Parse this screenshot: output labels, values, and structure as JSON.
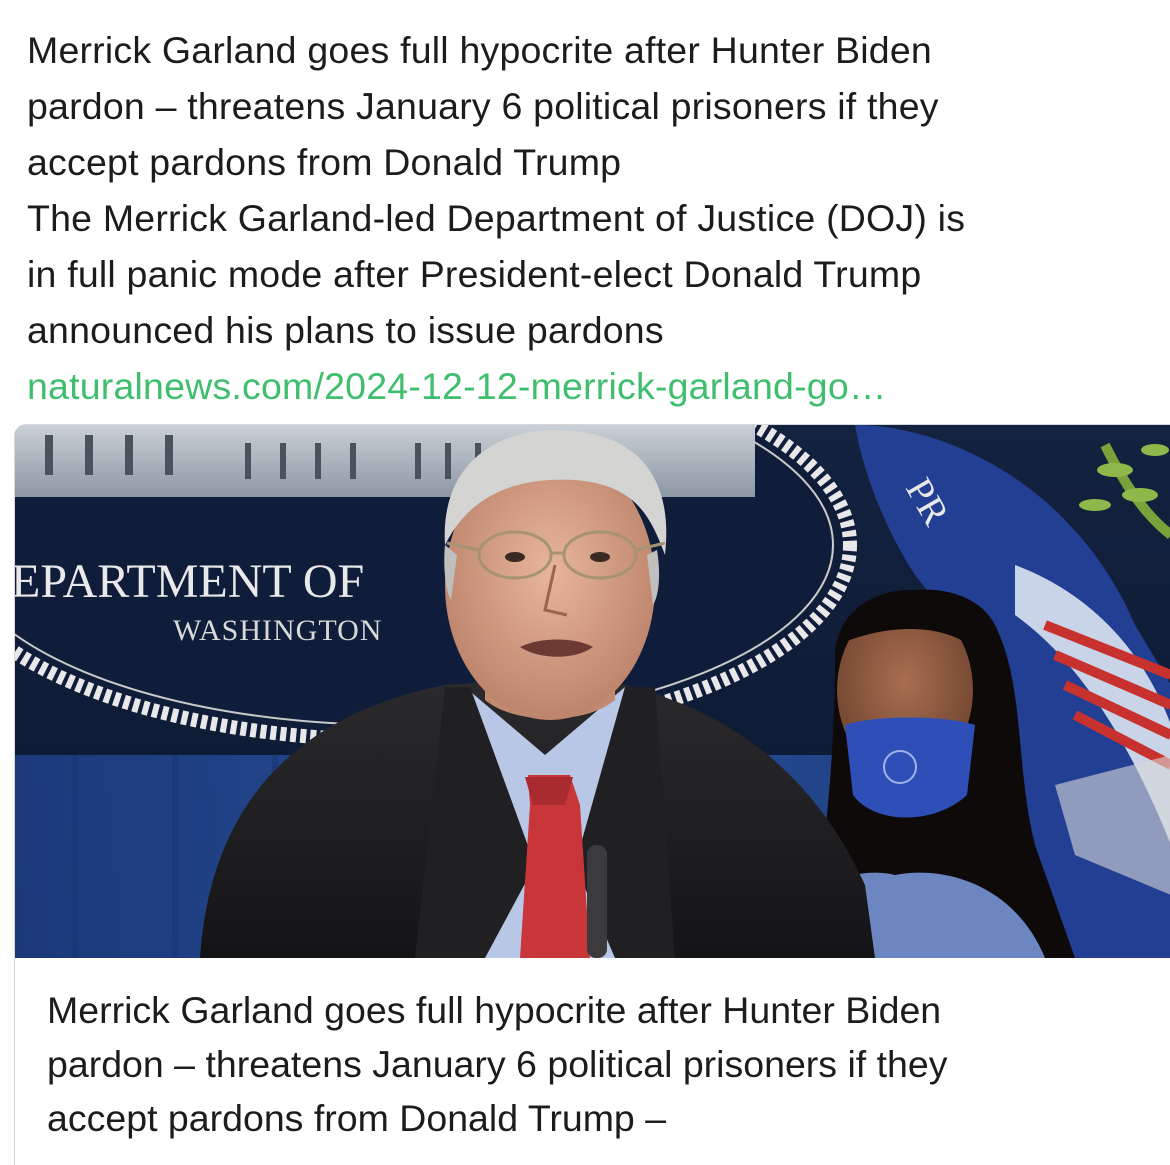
{
  "post": {
    "text_lines": [
      "Merrick Garland goes full hypocrite after Hunter Biden",
      "pardon – threatens January 6 political prisoners if they",
      "accept pardons from Donald Trump",
      "The Merrick Garland-led Department of Justice (DOJ) is",
      "in full panic mode after President-elect Donald Trump",
      "announced his plans to issue pardons"
    ],
    "link": "naturalnews.com/2024-12-12-merrick-garland-go…",
    "link_color": "#3fbf6e"
  },
  "card": {
    "image": {
      "seal_text": "EPARTMENT OF",
      "seal_subtext": "WASHINGTON",
      "flag_text": "PR"
    },
    "title_lines": [
      "Merrick Garland goes full hypocrite after Hunter Biden",
      "pardon – threatens January 6 political prisoners if they",
      "accept pardons from Donald Trump   –"
    ]
  }
}
